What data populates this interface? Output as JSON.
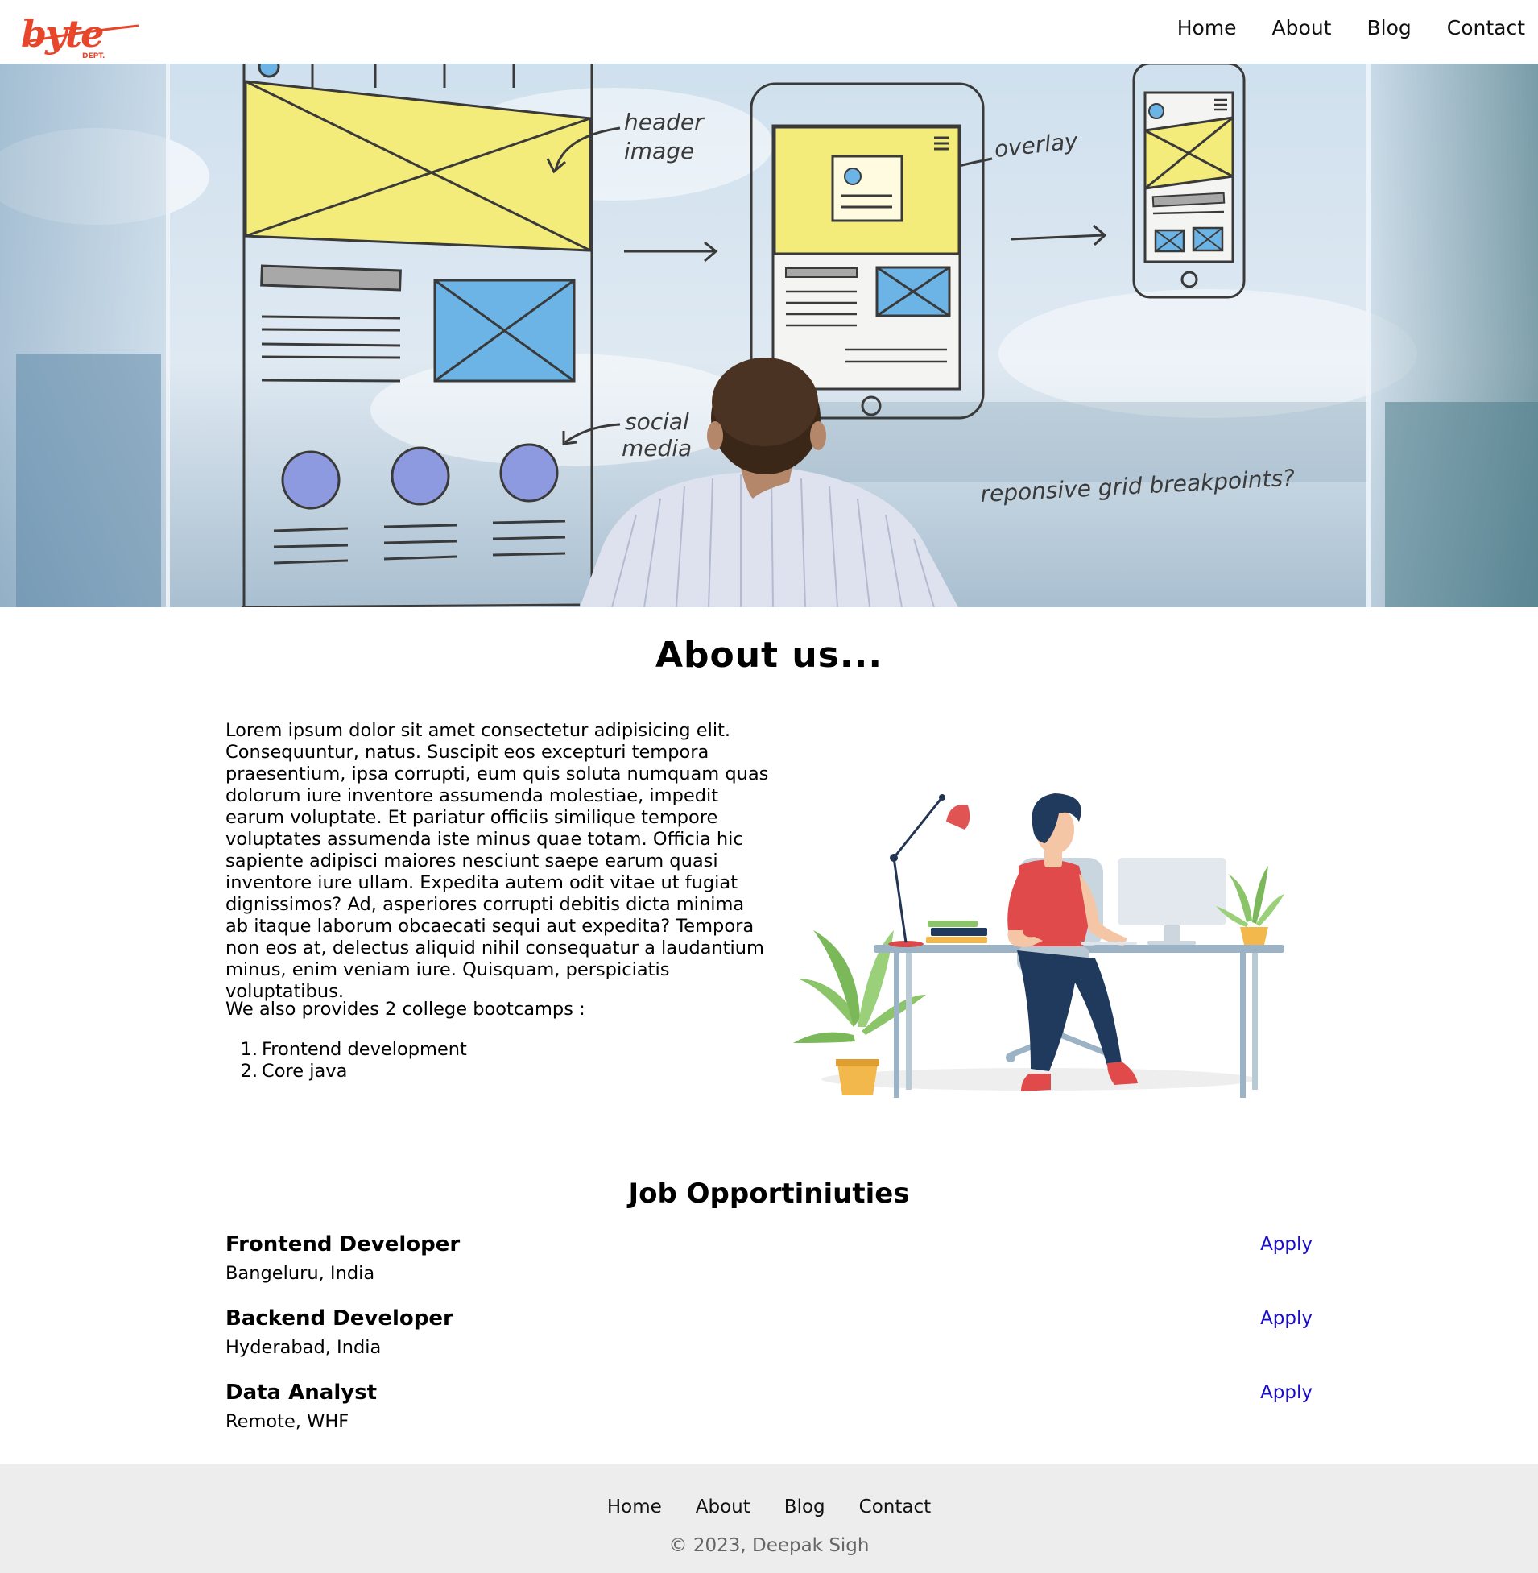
{
  "brand": {
    "logo_text": "byte",
    "logo_sub": "DEPT.",
    "color": "#e8462b"
  },
  "nav": {
    "items": [
      "Home",
      "About",
      "Blog",
      "Contact"
    ]
  },
  "hero": {
    "labels": {
      "header_image": [
        "header",
        "image"
      ],
      "overlay": "overlay",
      "social_media": [
        "social",
        "media"
      ],
      "question": "reponsive grid breakpoints?"
    }
  },
  "about": {
    "title": "About us...",
    "paragraph": "Lorem ipsum dolor sit amet consectetur adipisicing elit. Consequuntur, natus. Suscipit eos excepturi tempora praesentium, ipsa corrupti, eum quis soluta numquam quas dolorum iure inventore assumenda molestiae, impedit earum voluptate. Et pariatur officiis similique tempore voluptates assumenda iste minus quae totam. Officia hic sapiente adipisci maiores nesciunt saepe earum quasi inventore iure ullam. Expedita autem odit vitae ut fugiat dignissimos? Ad, asperiores corrupti debitis dicta minima ab itaque laborum obcaecati sequi aut expedita? Tempora non eos at, delectus aliquid nihil consequatur a laudantium minus, enim veniam iure. Quisquam, perspiciatis voluptatibus.",
    "subheading": "We also provides 2 college bootcamps :",
    "bootcamps": [
      {
        "num": "1.",
        "label": "Frontend development"
      },
      {
        "num": "2.",
        "label": "Core java"
      }
    ]
  },
  "jobs": {
    "title": "Job Opportiniuties",
    "items": [
      {
        "title": "Frontend Developer",
        "location": "Bangeluru, India",
        "apply": "Apply"
      },
      {
        "title": "Backend Developer",
        "location": "Hyderabad, India",
        "apply": "Apply"
      },
      {
        "title": "Data Analyst",
        "location": "Remote, WHF",
        "apply": "Apply"
      }
    ]
  },
  "footer": {
    "items": [
      "Home",
      "About",
      "Blog",
      "Contact"
    ],
    "copyright": "© 2023, Deepak Sigh"
  },
  "colors": {
    "apply_link": "#1a0dca",
    "footer_bg": "#ededee"
  }
}
